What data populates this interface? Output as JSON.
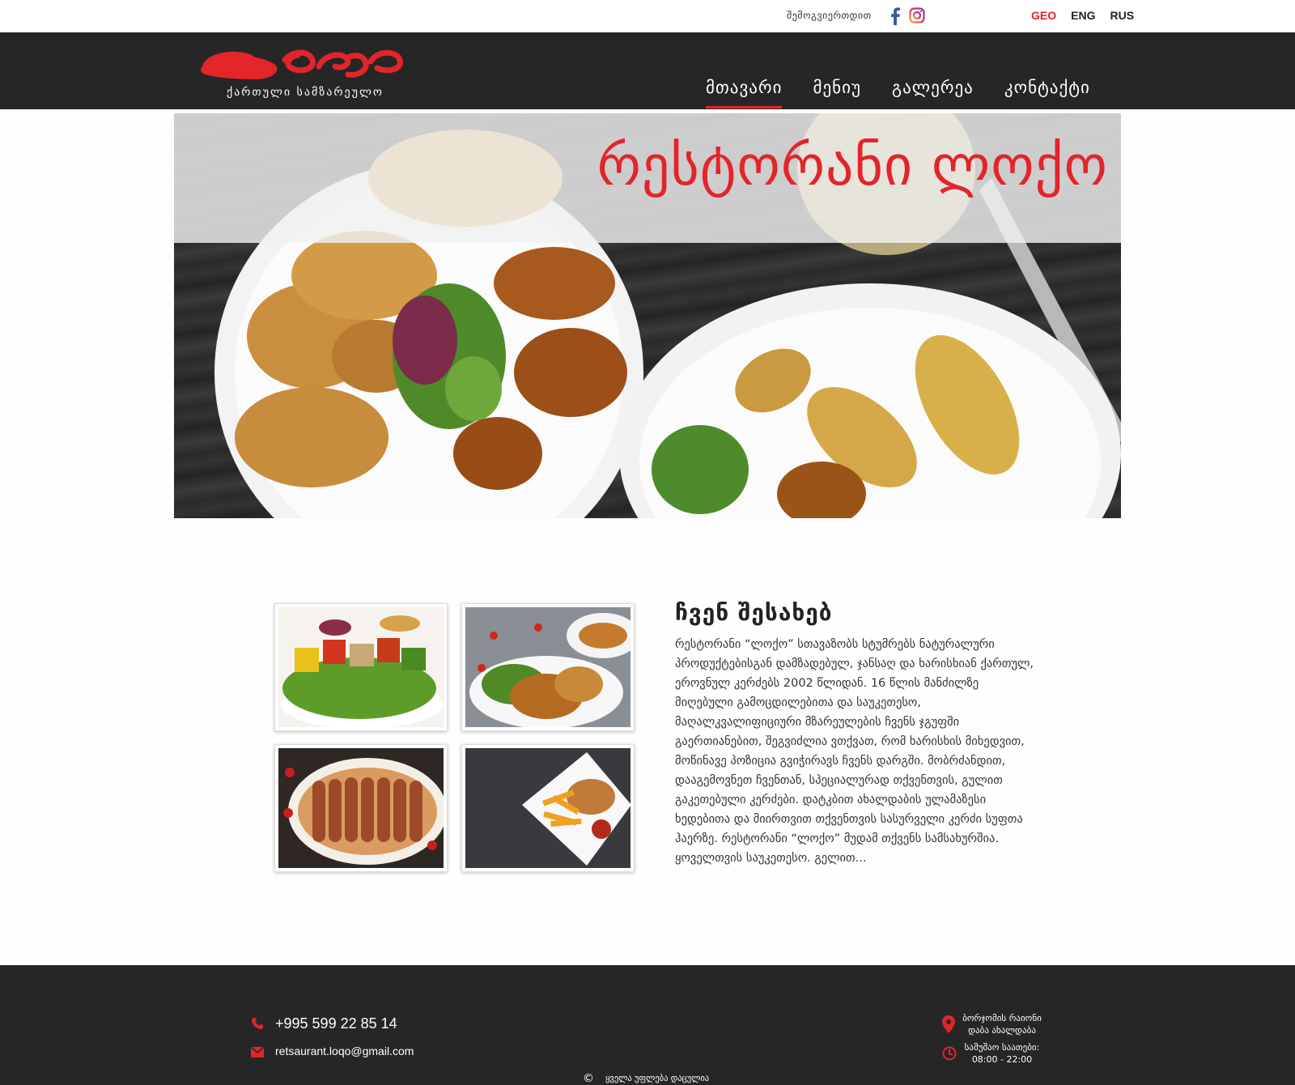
{
  "topbar": {
    "follow_label": "შემოგვიერთდით",
    "social": [
      {
        "icon": "facebook-icon",
        "color": "#3b5998"
      },
      {
        "icon": "instagram-icon",
        "color": "#c13584"
      }
    ],
    "languages": [
      {
        "label": "GEO",
        "active": true
      },
      {
        "label": "ENG",
        "active": false
      },
      {
        "label": "RUS",
        "active": false
      }
    ]
  },
  "header": {
    "logo_text": "ლოქო",
    "tagline": "ქართული სამზარეულო",
    "nav": [
      {
        "label": "მთავარი",
        "active": true
      },
      {
        "label": "მენიუ",
        "active": false
      },
      {
        "label": "გალერეა",
        "active": false
      },
      {
        "label": "კონტაქტი",
        "active": false
      }
    ]
  },
  "hero": {
    "title": "რესტორანი ლოქო"
  },
  "about": {
    "title": "ჩვენ შესახებ",
    "text": "რესტორანი “ლოქო” სთავაზობს სტუმრებს ნატურალური პროდუქტებისგან დამზადებულ, ჯანსაღ და ხარისხიან ქართულ, ეროვნულ კერძებს 2002 წლიდან. 16 წლის მანძილზე მიღებული გამოცდილებითა და საუკეთესო, მაღალკვალიფიციური მზარეულების ჩვენს ჯგუფში გაერთიანებით, შეგვიძლია ვთქვათ, რომ ხარისხის მიხედვით, მოწინავე პოზიცია გვიჭირავს ჩვენს დარგში. მობრძანდით, დააგემოვნეთ ჩვენთან, სპეციალურად თქვენთვის, გულით გაკეთებული კერძები. დატკბით ახალდაბის ულამაზესი ხედებითა და მიირთვით თქვენთვის სასურველი კერძი სუფთა ჰაერზე. რესტორანი “ლოქო” მუდამ თქვენს სამსახურშია. ყოველთვის საუკეთესო. გელით..."
  },
  "footer": {
    "phone": "+995 599 22 85 14",
    "email": "retsaurant.loqo@gmail.com",
    "address_line1": "ბორჯომის რაიონი",
    "address_line2": "დაბა ახალდაბა",
    "hours_label": "სამუშაო საათები:",
    "hours_value": "08:00 - 22:00",
    "copyright_symbol": "©",
    "copyright_text": "ყველა უფლება დაცულია"
  },
  "colors": {
    "accent": "#e3242b",
    "header_bg": "#262626",
    "footer_bg": "#262626"
  }
}
